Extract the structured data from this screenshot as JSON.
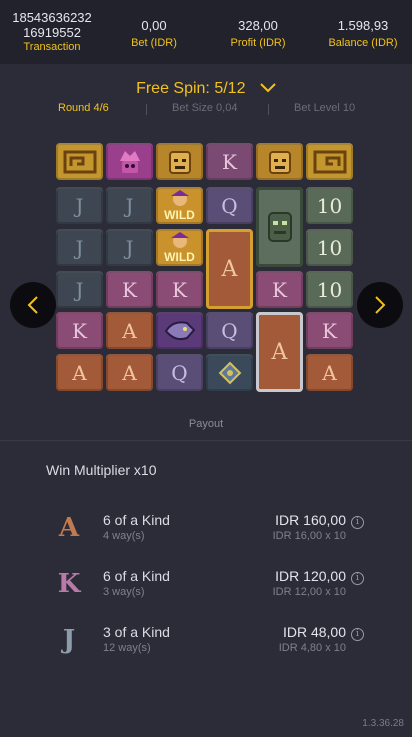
{
  "header": {
    "transaction_id_line1": "18543636232",
    "transaction_id_line2": "16919552",
    "transaction_label": "Transaction",
    "bet_value": "0,00",
    "bet_label": "Bet (IDR)",
    "profit_value": "328,00",
    "profit_label": "Profit (IDR)",
    "balance_value": "1.598,93",
    "balance_label": "Balance (IDR)"
  },
  "free_spin": {
    "label": "Free Spin: 5/12"
  },
  "subinfo": {
    "round": "Round 4/6",
    "bet_size": "Bet Size 0,04",
    "bet_level": "Bet Level 10"
  },
  "wild_label": "WILD",
  "reels": {
    "row1": [
      "scroll",
      "mask-pink",
      "mask-gold",
      "K",
      "mask-gold",
      "scroll"
    ],
    "row2": [
      "J",
      "J",
      "WILD",
      "Q",
      "idol-green",
      "10"
    ],
    "row3": [
      "J",
      "J",
      "WILD",
      "A",
      "idol-green",
      "10"
    ],
    "row4": [
      "J",
      "K",
      "K",
      "A",
      "K",
      "10"
    ],
    "row5": [
      "K",
      "A",
      "jaguar",
      "Q",
      "A",
      "K"
    ],
    "row6": [
      "A",
      "A",
      "Q",
      "amulet",
      "A",
      "A"
    ]
  },
  "payout": {
    "title": "Payout",
    "multiplier": "Win Multiplier x10",
    "wins": [
      {
        "symbol": "A",
        "kind": "6 of a Kind",
        "ways": "4 way(s)",
        "amount": "IDR 160,00",
        "calc": "IDR 16,00 x 10"
      },
      {
        "symbol": "K",
        "kind": "6 of a Kind",
        "ways": "3 way(s)",
        "amount": "IDR 120,00",
        "calc": "IDR 12,00 x 10"
      },
      {
        "symbol": "J",
        "kind": "3 of a Kind",
        "ways": "12 way(s)",
        "amount": "IDR 48,00",
        "calc": "IDR 4,80 x 10"
      }
    ]
  },
  "info_glyph": "i",
  "version": "1.3.36.28",
  "colors": {
    "accent": "#f2c21b",
    "background": "#2c2c38",
    "topbar": "#22222c"
  }
}
